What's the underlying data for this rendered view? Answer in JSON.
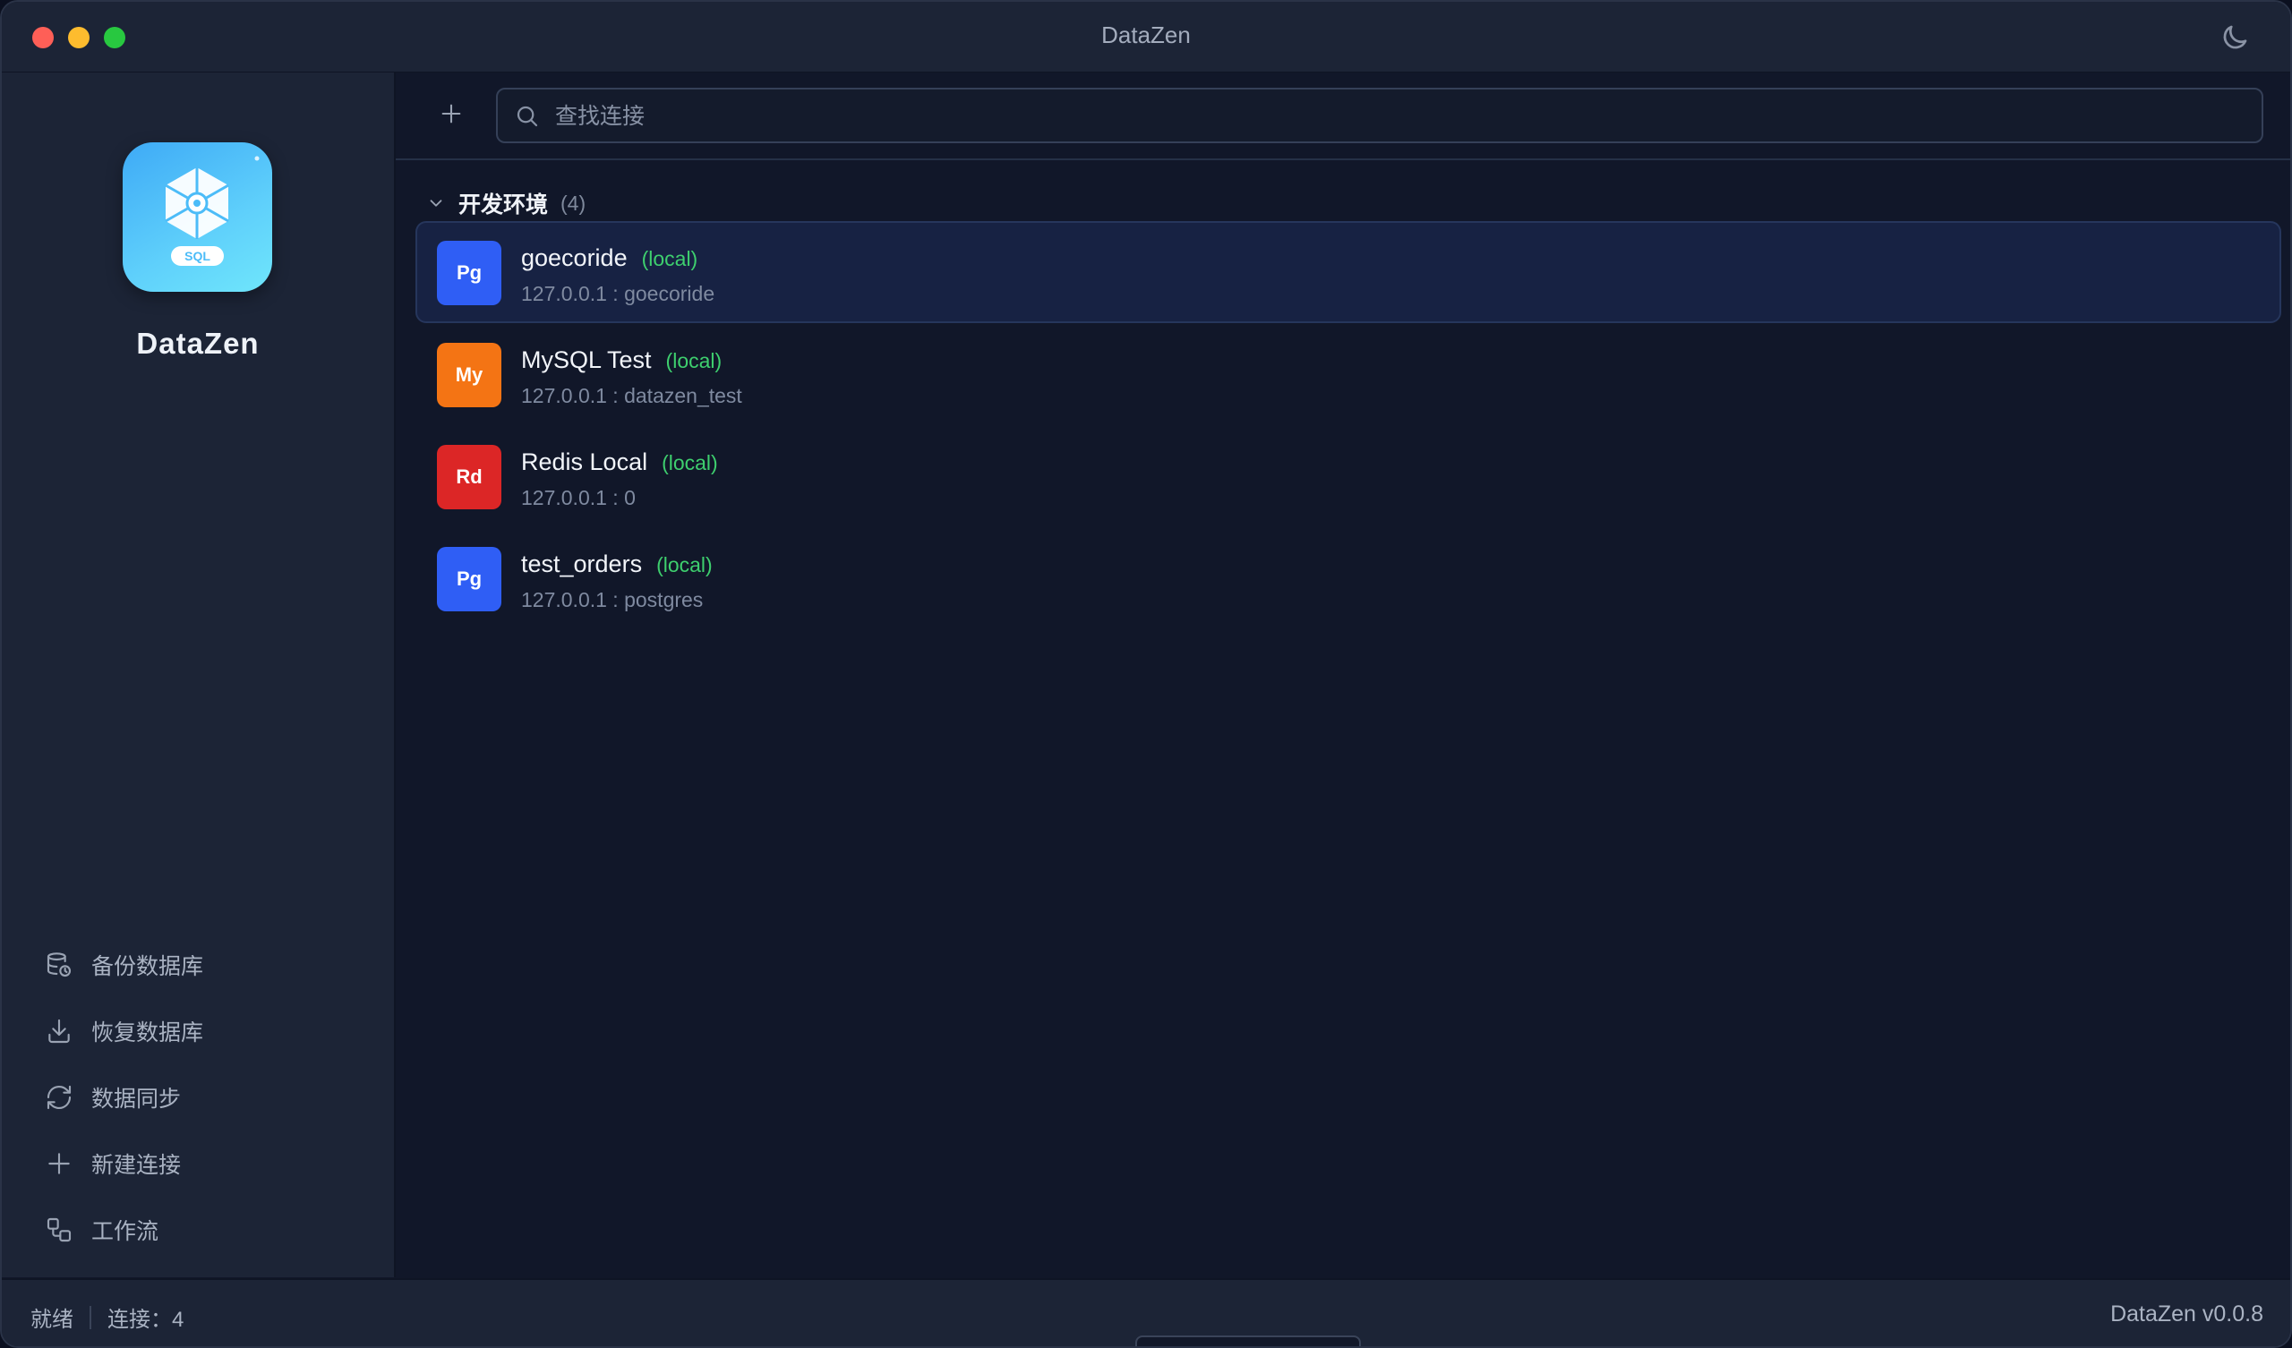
{
  "window": {
    "title": "DataZen"
  },
  "sidebar": {
    "app_name": "DataZen",
    "logo_label": "SQL",
    "items": [
      {
        "label": "备份数据库",
        "icon": "database-backup-icon"
      },
      {
        "label": "恢复数据库",
        "icon": "download-icon"
      },
      {
        "label": "数据同步",
        "icon": "sync-icon"
      },
      {
        "label": "新建连接",
        "icon": "plus-icon"
      },
      {
        "label": "工作流",
        "icon": "workflow-icon"
      }
    ]
  },
  "search": {
    "placeholder": "查找连接",
    "value": ""
  },
  "group": {
    "title": "开发环境",
    "count": "(4)"
  },
  "connections": [
    {
      "badge": "Pg",
      "badge_color": "#2f5ef5",
      "name": "goecoride",
      "tag": "(local)",
      "address": "127.0.0.1 : goecoride",
      "selected": true
    },
    {
      "badge": "My",
      "badge_color": "#f47414",
      "name": "MySQL Test",
      "tag": "(local)",
      "address": "127.0.0.1 : datazen_test",
      "selected": false
    },
    {
      "badge": "Rd",
      "badge_color": "#dc2626",
      "name": "Redis Local",
      "tag": "(local)",
      "address": "127.0.0.1 : 0",
      "selected": false
    },
    {
      "badge": "Pg",
      "badge_color": "#2f5ef5",
      "name": "test_orders",
      "tag": "(local)",
      "address": "127.0.0.1 : postgres",
      "selected": false
    }
  ],
  "statusbar": {
    "status": "就绪",
    "connections": "连接：4",
    "version": "DataZen v0.0.8"
  },
  "colors": {
    "accent_local": "#3ecf6e",
    "background": "#111729",
    "sidebar": "#1c2436"
  }
}
